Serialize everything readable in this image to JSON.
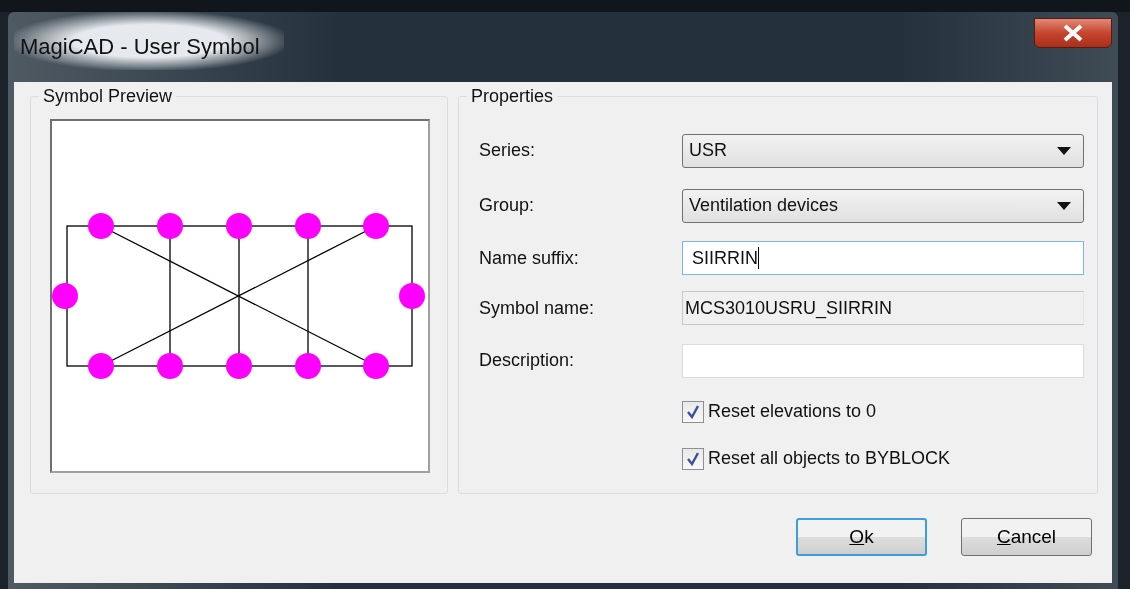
{
  "window": {
    "title": "MagiCAD - User Symbol"
  },
  "preview": {
    "title": "Symbol Preview"
  },
  "properties": {
    "title": "Properties",
    "fields": [
      {
        "label": "Series:",
        "kind": "dropdown",
        "value": "USR"
      },
      {
        "label": "Group:",
        "kind": "dropdown",
        "value": "Ventilation devices"
      },
      {
        "label": "Name suffix:",
        "kind": "input",
        "value": "SIIRRIN",
        "focused": true
      },
      {
        "label": "Symbol name:",
        "kind": "readonly",
        "value": "MCS3010USRU_SIIRRIN"
      },
      {
        "label": "Description:",
        "kind": "input",
        "focused": false
      }
    ],
    "checkboxes": [
      {
        "label": "Reset elevations to 0",
        "checked": true
      },
      {
        "label": "Reset all objects to BYBLOCK",
        "checked": true
      }
    ]
  },
  "buttons": [
    {
      "label": "Ok",
      "default": true
    },
    {
      "label": "Cancel",
      "default": false
    }
  ]
}
